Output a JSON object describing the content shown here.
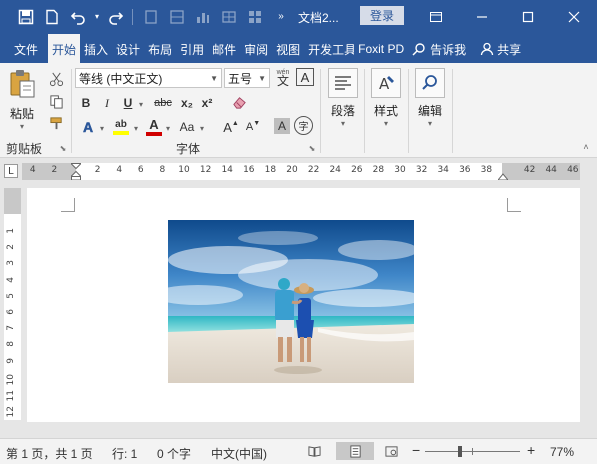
{
  "app": {
    "doc_title": "文档2...",
    "login_label": "登录"
  },
  "tabs": [
    {
      "label": "文件",
      "active": false
    },
    {
      "label": "开始",
      "active": true
    },
    {
      "label": "插入",
      "active": false
    },
    {
      "label": "设计",
      "active": false
    },
    {
      "label": "布局",
      "active": false
    },
    {
      "label": "引用",
      "active": false
    },
    {
      "label": "邮件",
      "active": false
    },
    {
      "label": "审阅",
      "active": false
    },
    {
      "label": "视图",
      "active": false
    },
    {
      "label": "开发工具",
      "active": false
    },
    {
      "label": "Foxit PD",
      "active": false
    }
  ],
  "tellme_label": "告诉我",
  "share_label": "共享",
  "ribbon": {
    "clipboard": {
      "paste_label": "粘贴",
      "group_label": "剪贴板"
    },
    "font": {
      "font_name": "等线 (中文正文)",
      "font_size": "五号",
      "group_label": "字体",
      "wen_label": "wén",
      "wen_char": "文",
      "border_char": "A",
      "bold": "B",
      "italic": "I",
      "underline": "U",
      "strike": "abc",
      "subscript": "x₂",
      "superscript": "x²",
      "effects": "A",
      "highlight": "ab",
      "fontcolor": "A",
      "aa": "Aa",
      "grow": "A",
      "shrink": "A",
      "shade_char": "A",
      "enclose_char": "字"
    },
    "paragraph": {
      "label": "段落"
    },
    "styles": {
      "label": "样式"
    },
    "editing": {
      "label": "编辑"
    }
  },
  "ruler": {
    "selector": "L",
    "left_labels": [
      "4",
      "2"
    ],
    "labels": [
      "2",
      "4",
      "6",
      "8",
      "10",
      "12",
      "14",
      "16",
      "18",
      "20",
      "22",
      "24",
      "26",
      "28",
      "30",
      "32",
      "34",
      "36",
      "38"
    ],
    "right_labels": [
      "42",
      "44",
      "46"
    ],
    "v_labels": [
      "1",
      "2",
      "3",
      "4",
      "5",
      "6",
      "7",
      "8",
      "9",
      "10",
      "11",
      "12"
    ]
  },
  "status": {
    "page": "第 1 页，共 1 页",
    "line": "行: 1",
    "words": "0 个字",
    "lang": "中文(中国)",
    "zoom": "77%",
    "zoom_minus": "−",
    "zoom_plus": "+",
    "zoom_level": 0.77
  },
  "colors": {
    "brand": "#2b579a",
    "highlight": "#ffff00",
    "font_red": "#d00000"
  }
}
